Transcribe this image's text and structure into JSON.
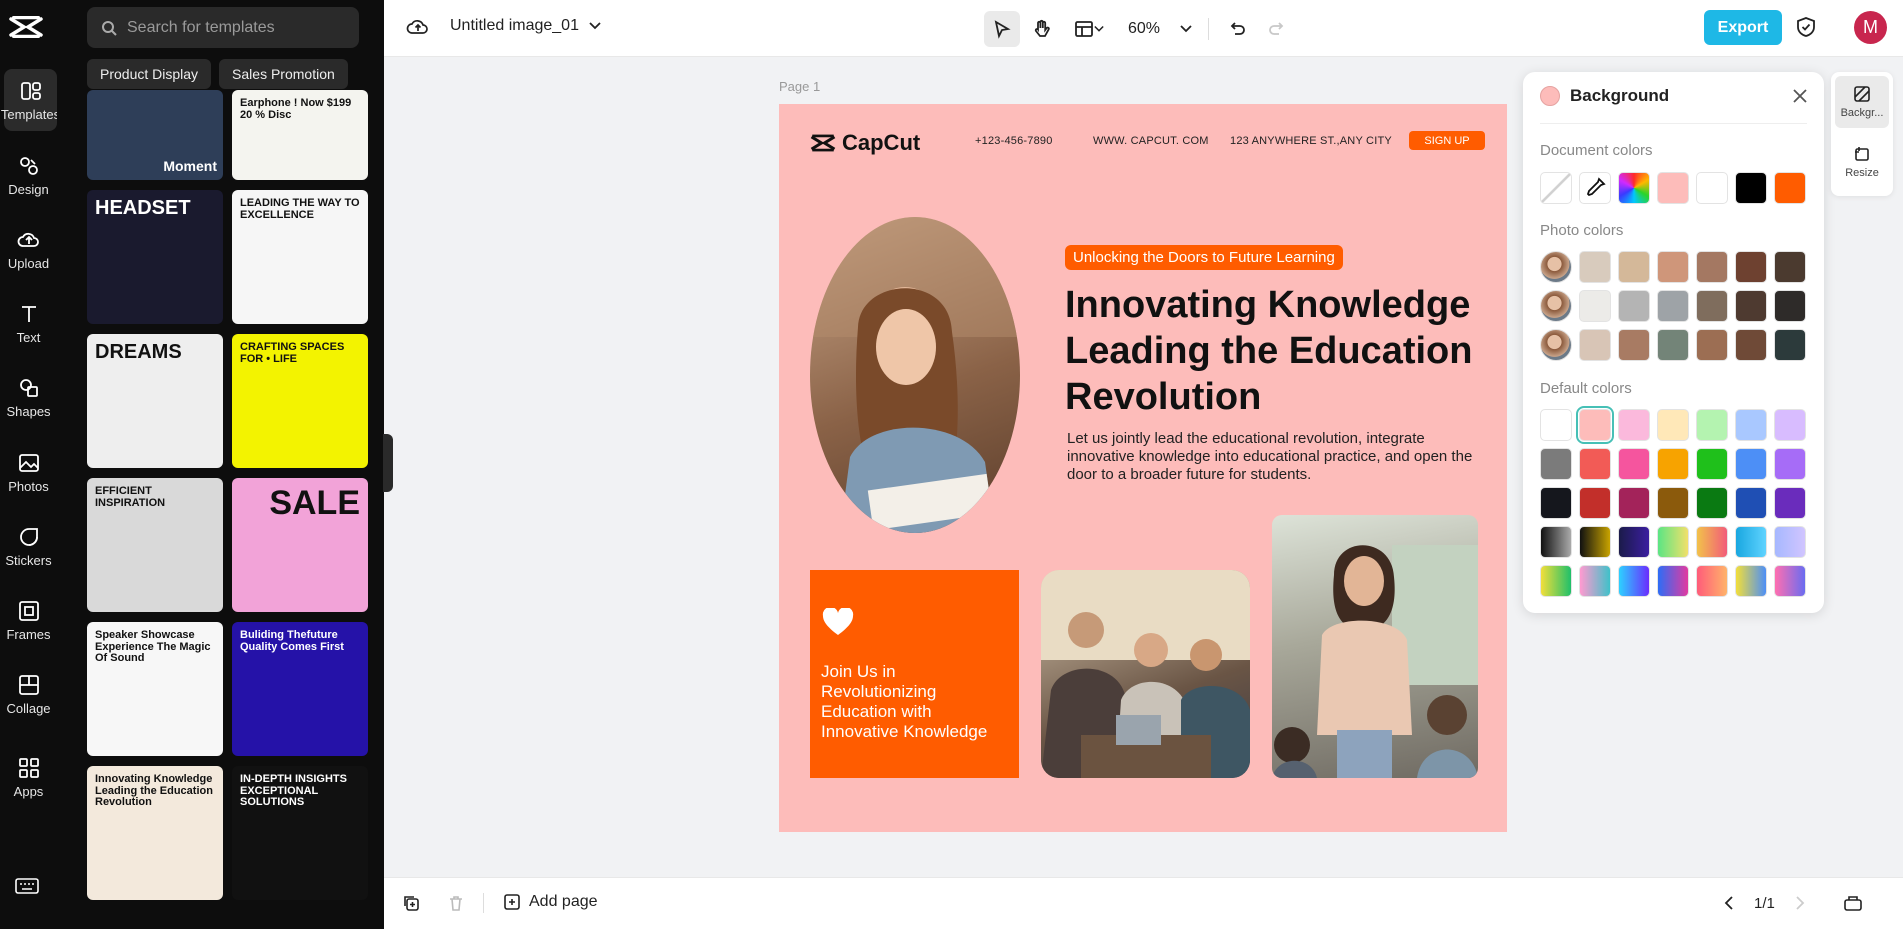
{
  "nav": {
    "items": [
      {
        "label": "Templates",
        "icon": "templates-icon"
      },
      {
        "label": "Design",
        "icon": "design-icon"
      },
      {
        "label": "Upload",
        "icon": "upload-icon"
      },
      {
        "label": "Text",
        "icon": "text-icon"
      },
      {
        "label": "Shapes",
        "icon": "shapes-icon"
      },
      {
        "label": "Photos",
        "icon": "photos-icon"
      },
      {
        "label": "Stickers",
        "icon": "stickers-icon"
      },
      {
        "label": "Frames",
        "icon": "frames-icon"
      },
      {
        "label": "Collage",
        "icon": "collage-icon"
      },
      {
        "label": "Apps",
        "icon": "apps-icon"
      }
    ]
  },
  "panel": {
    "search_placeholder": "Search for templates",
    "chips": [
      "Product Display",
      "Sales Promotion"
    ],
    "templates": [
      {
        "title": "Moment",
        "bg": "#2e3e58",
        "fg": "#ffffff"
      },
      {
        "title": "Earphone ! Now $199 20 % Disc",
        "bg": "#f4f4ef",
        "fg": "#111111"
      },
      {
        "title": "HEADSET",
        "bg": "#1a1a2e",
        "fg": "#ffffff"
      },
      {
        "title": "LEADING THE WAY TO EXCELLENCE",
        "bg": "#f6f6f6",
        "fg": "#111111"
      },
      {
        "title": "DREAMS",
        "bg": "#eeeeee",
        "fg": "#111111"
      },
      {
        "title": "CRAFTING SPACES FOR • LIFE",
        "bg": "#f3f300",
        "fg": "#111111"
      },
      {
        "title": "EFFICIENT INSPIRATION",
        "bg": "#d9d9d9",
        "fg": "#111111"
      },
      {
        "title": "SALE",
        "bg": "#f2a3d8",
        "fg": "#111111"
      },
      {
        "title": "Speaker Showcase Experience The Magic Of Sound",
        "bg": "#f7f7f7",
        "fg": "#111111"
      },
      {
        "title": "Buliding Thefuture Quality Comes First",
        "bg": "#2512a8",
        "fg": "#ffffff"
      },
      {
        "title": "Innovating Knowledge Leading the Education Revolution",
        "bg": "#f3e9dc",
        "fg": "#111111"
      },
      {
        "title": "IN-DEPTH INSIGHTS EXCEPTIONAL SOLUTIONS",
        "bg": "#111111",
        "fg": "#ffffff"
      }
    ]
  },
  "topbar": {
    "title": "Untitled image_01",
    "zoom": "60%",
    "export_label": "Export",
    "avatar_letter": "M"
  },
  "canvas": {
    "page_label": "Page 1",
    "logo_text": "CapCut",
    "phone": "+123-456-7890",
    "website": "WWW. CAPCUT. COM",
    "address": "123 ANYWHERE ST.,ANY CITY",
    "signup": "SIGN UP",
    "pill": "Unlocking the Doors to Future Learning",
    "headline": [
      "Innovating Knowledge",
      "Leading the Education",
      "Revolution"
    ],
    "body": "Let us jointly lead the educational revolution, integrate innovative knowledge into educational practice, and open the door to a broader future for students.",
    "orange_box_text": "Join Us in Revolutionizing Education with Innovative Knowledge",
    "background_color": "#fdbcba",
    "accent_color": "#ff5c00"
  },
  "bottombar": {
    "add_page": "Add page",
    "page_count": "1/1"
  },
  "background_panel": {
    "title": "Background",
    "document_colors_label": "Document colors",
    "photo_colors_label": "Photo colors",
    "default_colors_label": "Default colors",
    "document_colors": [
      "transparent",
      "eyedropper",
      "spectrum",
      "#fdbcba",
      "#ffffff",
      "#000000",
      "#ff5c00"
    ],
    "photo_colors": [
      [
        "photo",
        "#d8cbbd",
        "#d4b899",
        "#cf967a",
        "#a47862",
        "#6e4130",
        "#4b3a2f"
      ],
      [
        "photo",
        "#ecebe8",
        "#b4b4b4",
        "#9ea3a7",
        "#7f6d5d",
        "#4e3a30",
        "#2e2b29"
      ],
      [
        "photo",
        "#d8c5b6",
        "#a87b63",
        "#738478",
        "#9c6e53",
        "#6f4a37",
        "#2c3a3b"
      ]
    ],
    "default_colors": [
      [
        "#ffffff",
        "#fdbcba",
        "#fbb9dc",
        "#ffe8b8",
        "#b4f3b0",
        "#a9c8ff",
        "#d8bcff"
      ],
      [
        "#7b7b7b",
        "#f25b56",
        "#f5559e",
        "#f7a300",
        "#1fc01b",
        "#4d8ff6",
        "#a66cf7"
      ],
      [
        "#15171d",
        "#c22f2a",
        "#a3235a",
        "#8b5a0c",
        "#0a7a12",
        "#1f4fb4",
        "#6a2cbc"
      ],
      [
        "linear-gradient(90deg,#111,#aaa)",
        "linear-gradient(90deg,#111,#c8a300)",
        "linear-gradient(90deg,#1b1b4a,#3b1ea0)",
        "linear-gradient(90deg,#5be584,#f2e06a)",
        "linear-gradient(90deg,#f2c24a,#f25b7a)",
        "linear-gradient(90deg,#19a7e0,#5fd3ff)",
        "linear-gradient(90deg,#a6b8ff,#d1c5ff)"
      ],
      [
        "linear-gradient(90deg,#f2de3a,#1fc06a)",
        "linear-gradient(90deg,#ff9ad0,#3fc1c9)",
        "linear-gradient(90deg,#2dd1ff,#6a2cfe)",
        "linear-gradient(90deg,#2d6df6,#e23aa0)",
        "linear-gradient(90deg,#ff5c7a,#ffb36a)",
        "linear-gradient(90deg,#f2de3a,#4d8ff6)",
        "linear-gradient(90deg,#ff6fb0,#6a6cf0)"
      ]
    ],
    "selected_default": [
      0,
      1
    ]
  },
  "rail": {
    "background_label": "Backgr...",
    "resize_label": "Resize"
  }
}
